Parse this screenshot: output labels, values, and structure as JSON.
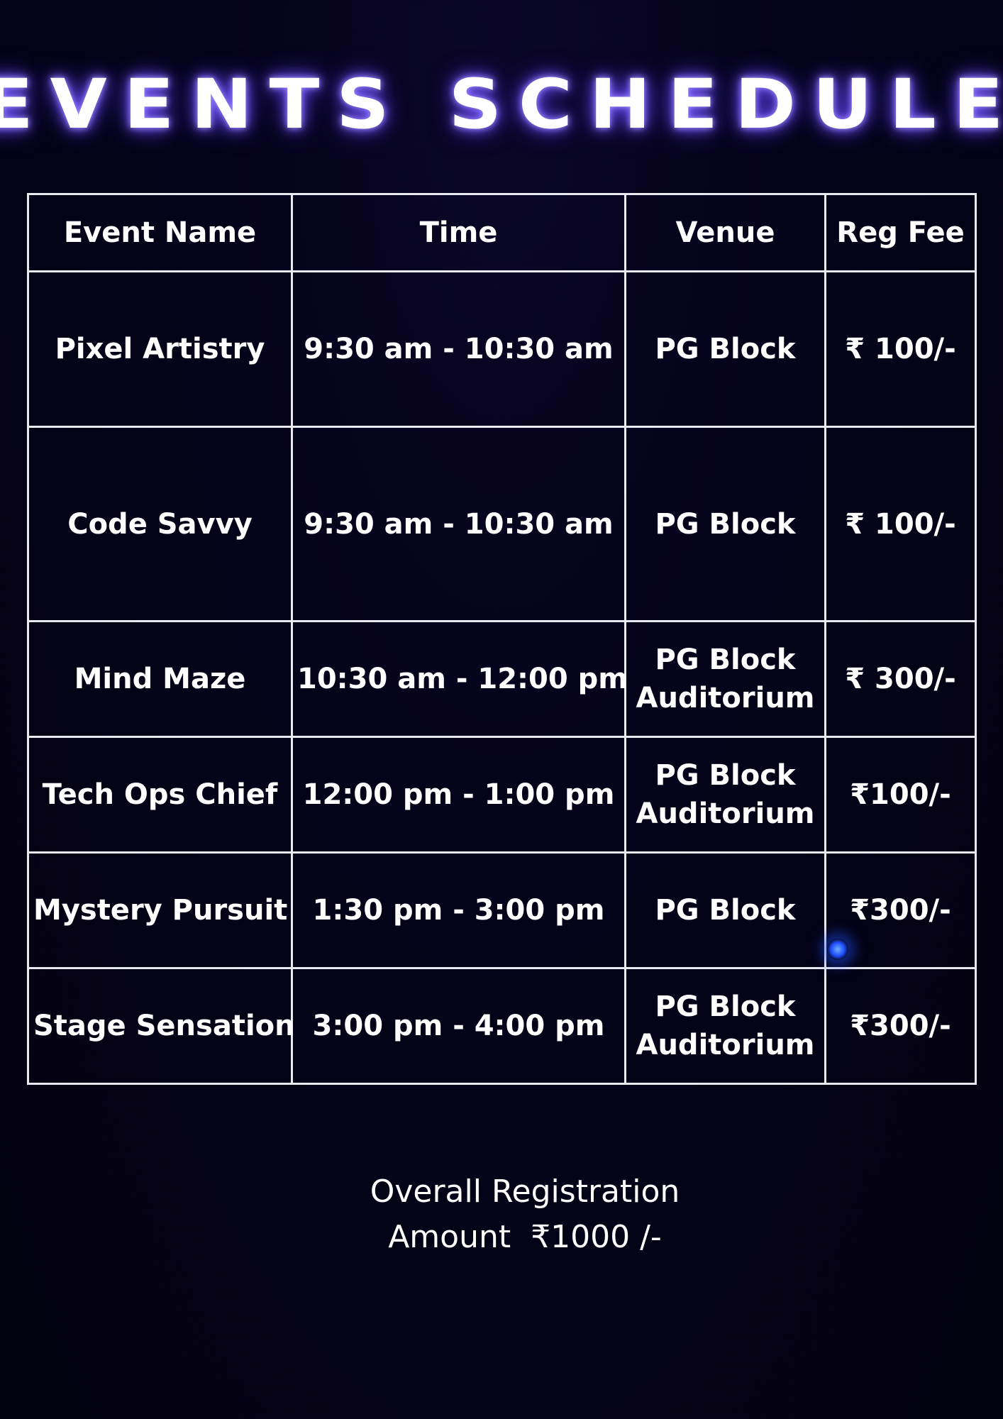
{
  "title": "EVENTS SCHEDULE",
  "table": {
    "headers": [
      "Event Name",
      "Time",
      "Venue",
      "Reg Fee"
    ],
    "rows": [
      {
        "event": "Pixel Artistry",
        "time": "9:30 am  -  10:30 am",
        "venue_line1": "PG Block",
        "venue_line2": "",
        "fee": "₹ 100/-"
      },
      {
        "event": "Code Savvy",
        "time": "9:30 am  - 10:30 am",
        "venue_line1": "PG Block",
        "venue_line2": "",
        "fee": "₹ 100/-"
      },
      {
        "event": "Mind Maze",
        "time": "10:30 am  - 12:00 pm",
        "venue_line1": "PG Block",
        "venue_line2": "Auditorium",
        "fee": "₹ 300/-"
      },
      {
        "event": "Tech Ops Chief",
        "time": "12:00 pm - 1:00 pm",
        "venue_line1": "PG Block",
        "venue_line2": "Auditorium",
        "fee": "₹100/-"
      },
      {
        "event": "Mystery Pursuit",
        "time": "1:30 pm - 3:00 pm",
        "venue_line1": "PG Block",
        "venue_line2": "",
        "fee": "₹300/-"
      },
      {
        "event": "Stage Sensation",
        "time": "3:00 pm - 4:00 pm",
        "venue_line1": "PG Block",
        "venue_line2": "Auditorium",
        "fee": "₹300/-"
      }
    ]
  },
  "footer": {
    "line1": "Overall Registration",
    "amount_label": "Amount",
    "amount_value": "₹1000 /-"
  }
}
